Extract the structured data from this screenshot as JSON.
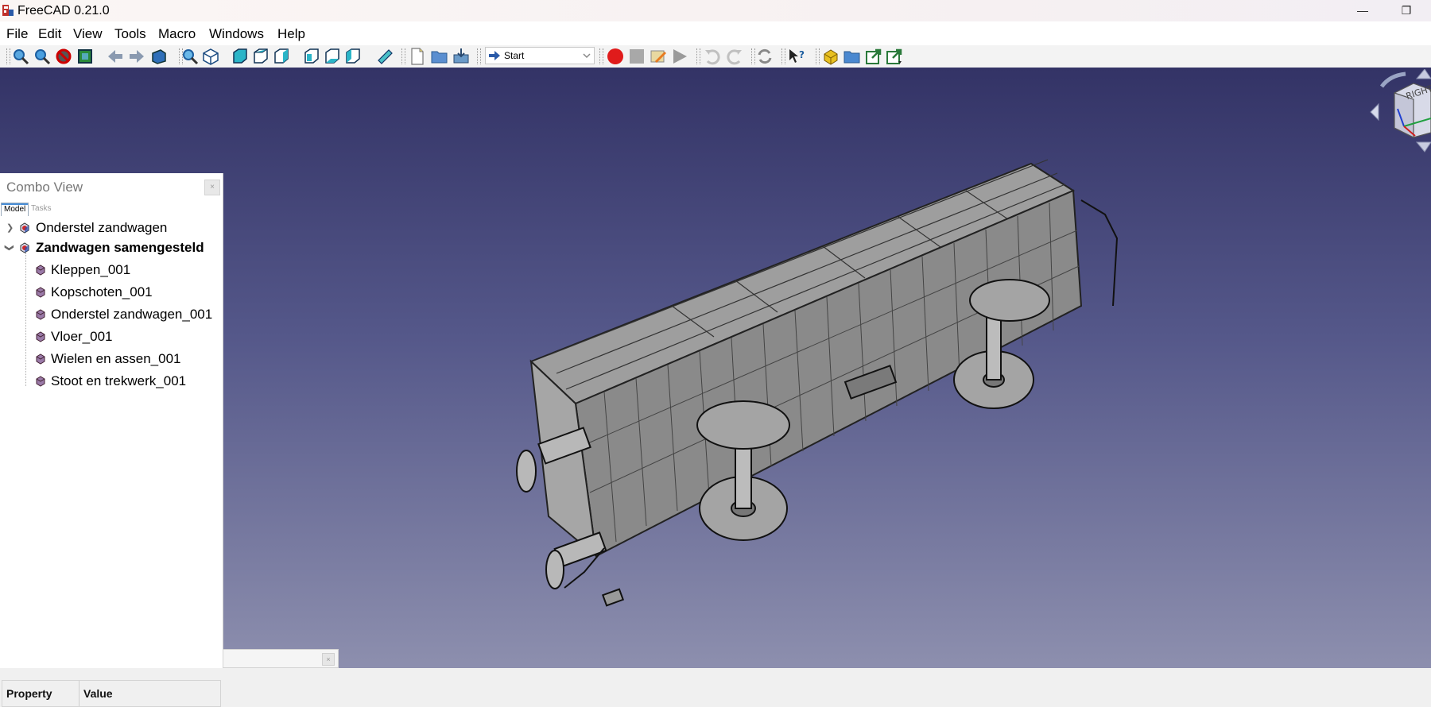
{
  "window": {
    "title": "FreeCAD 0.21.0",
    "minimize_glyph": "—",
    "restore_glyph": "❐"
  },
  "menu": [
    "File",
    "Edit",
    "View",
    "Tools",
    "Macro",
    "Windows",
    "Help"
  ],
  "toolbar": {
    "workbench": "Start"
  },
  "combo_view": {
    "title": "Combo View",
    "close_glyph": "×",
    "tabs": [
      "Model",
      "Tasks"
    ],
    "tree": [
      {
        "label": "Onderstel zandwagen",
        "level": 0,
        "expanded": false
      },
      {
        "label": "Zandwagen samengesteld",
        "level": 0,
        "expanded": true,
        "bold": true
      },
      {
        "label": "Kleppen_001",
        "level": 1
      },
      {
        "label": "Kopschoten_001",
        "level": 1
      },
      {
        "label": "Onderstel zandwagen_001",
        "level": 1
      },
      {
        "label": "Vloer_001",
        "level": 1
      },
      {
        "label": "Wielen en assen_001",
        "level": 1
      },
      {
        "label": "Stoot en trekwerk_001",
        "level": 1
      }
    ],
    "property_columns": [
      "Property",
      "Value"
    ]
  },
  "navcube": {
    "face": "RIGHT"
  }
}
